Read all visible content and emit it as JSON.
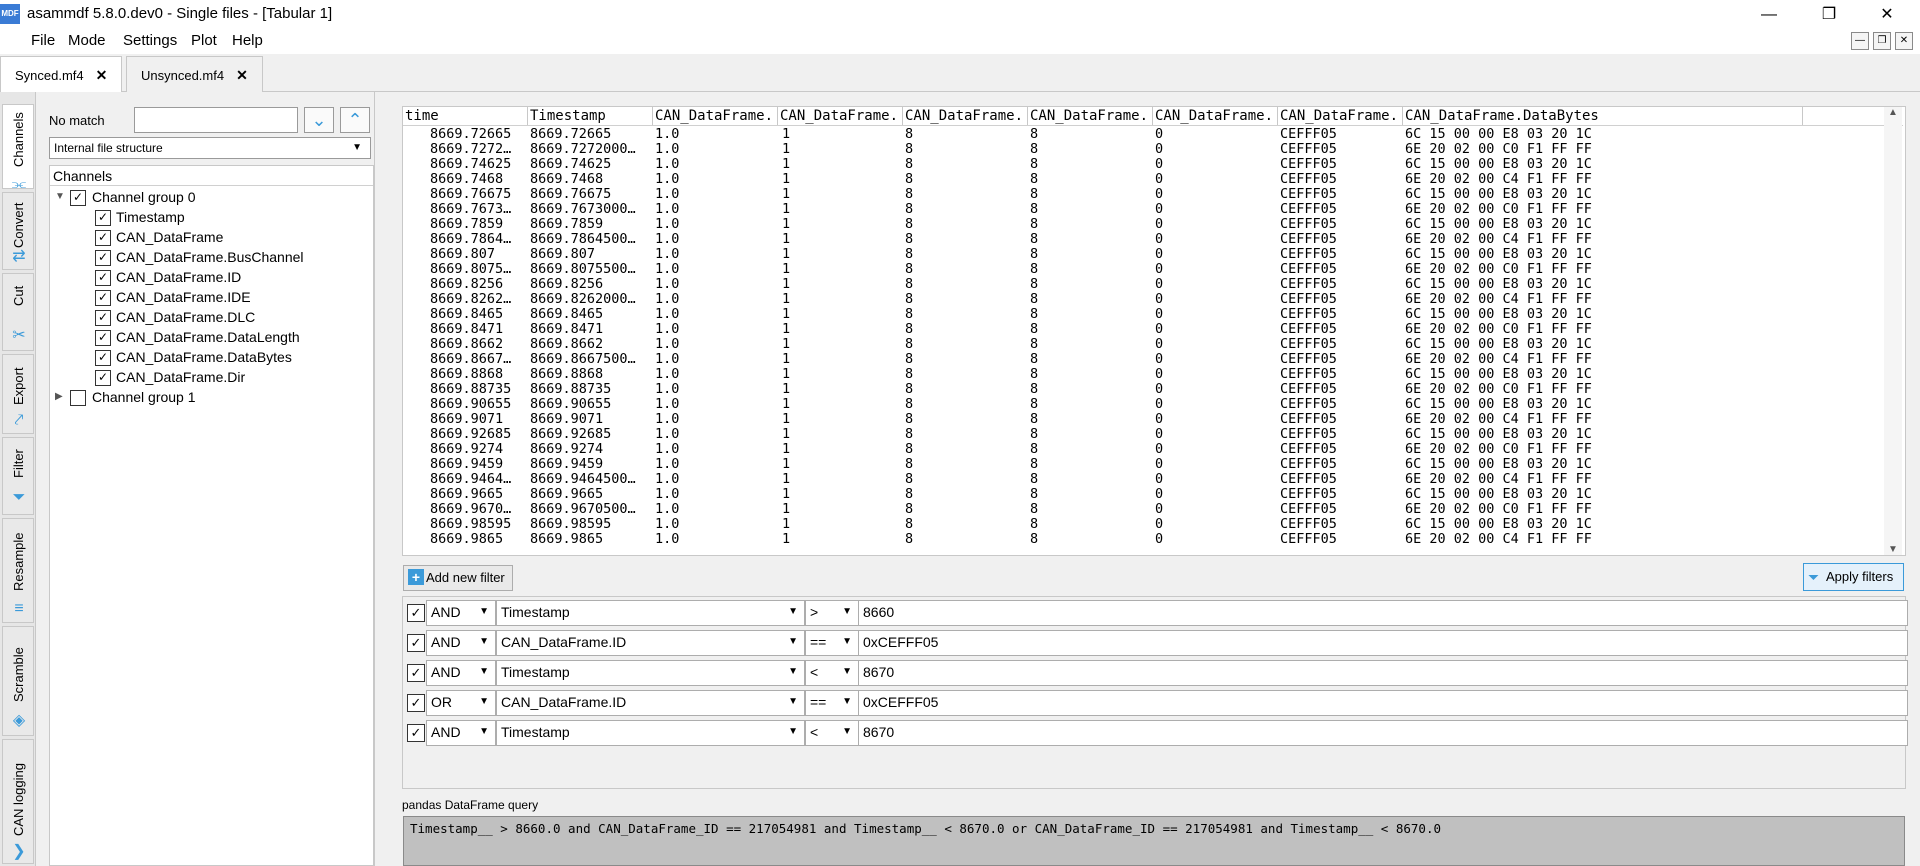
{
  "window": {
    "title": "asammdf 5.8.0.dev0 - Single files - [Tabular 1]",
    "logo_text": "MDF",
    "controls": {
      "minimize": "—",
      "maximize": "❐",
      "close": "✕"
    }
  },
  "menu": {
    "items": [
      "File",
      "Mode",
      "Settings",
      "Plot",
      "Help"
    ],
    "mdi_controls": {
      "minimize": "—",
      "restore": "❐",
      "close": "✕"
    }
  },
  "tabs": [
    {
      "label": "Synced.mf4",
      "close": "✕",
      "active": true
    },
    {
      "label": "Unsynced.mf4",
      "close": "✕",
      "active": false
    }
  ],
  "side_tabs": [
    {
      "label": "Channels",
      "icon": "channels-icon"
    },
    {
      "label": "Convert",
      "icon": "convert-icon"
    },
    {
      "label": "Cut",
      "icon": "scissors-icon"
    },
    {
      "label": "Export",
      "icon": "export-icon"
    },
    {
      "label": "Filter",
      "icon": "funnel-icon"
    },
    {
      "label": "Resample",
      "icon": "resample-icon"
    },
    {
      "label": "Scramble",
      "icon": "scramble-icon"
    },
    {
      "label": "CAN logging",
      "icon": "can-icon"
    }
  ],
  "channels_panel": {
    "match_status": "No match",
    "search_value": "",
    "view_mode": "Internal file structure",
    "tree_header": "Channels",
    "groups": [
      {
        "label": "Channel group 0",
        "checked": true,
        "expanded": true,
        "channels": [
          "Timestamp",
          "CAN_DataFrame",
          "CAN_DataFrame.BusChannel",
          "CAN_DataFrame.ID",
          "CAN_DataFrame.IDE",
          "CAN_DataFrame.DLC",
          "CAN_DataFrame.DataLength",
          "CAN_DataFrame.DataBytes",
          "CAN_DataFrame.Dir"
        ]
      },
      {
        "label": "Channel group 1",
        "checked": false,
        "expanded": false,
        "channels": []
      }
    ]
  },
  "table": {
    "columns": [
      "time",
      "Timestamp",
      "CAN_DataFrame.",
      "CAN_DataFrame.",
      "CAN_DataFrame.",
      "CAN_DataFrame.",
      "CAN_DataFrame.",
      "CAN_DataFrame.",
      "CAN_DataFrame.DataBytes"
    ],
    "rows": [
      [
        "8669.72665",
        "8669.72665",
        "1.0",
        "1",
        "8",
        "8",
        "0",
        "CEFFF05",
        "6C 15 00 00 E8 03 20 1C"
      ],
      [
        "8669.7272…",
        "8669.7272000…",
        "1.0",
        "1",
        "8",
        "8",
        "0",
        "CEFFF05",
        "6E 20 02 00 C0 F1 FF FF"
      ],
      [
        "8669.74625",
        "8669.74625",
        "1.0",
        "1",
        "8",
        "8",
        "0",
        "CEFFF05",
        "6C 15 00 00 E8 03 20 1C"
      ],
      [
        "8669.7468",
        "8669.7468",
        "1.0",
        "1",
        "8",
        "8",
        "0",
        "CEFFF05",
        "6E 20 02 00 C4 F1 FF FF"
      ],
      [
        "8669.76675",
        "8669.76675",
        "1.0",
        "1",
        "8",
        "8",
        "0",
        "CEFFF05",
        "6C 15 00 00 E8 03 20 1C"
      ],
      [
        "8669.7673…",
        "8669.7673000…",
        "1.0",
        "1",
        "8",
        "8",
        "0",
        "CEFFF05",
        "6E 20 02 00 C0 F1 FF FF"
      ],
      [
        "8669.7859",
        "8669.7859",
        "1.0",
        "1",
        "8",
        "8",
        "0",
        "CEFFF05",
        "6C 15 00 00 E8 03 20 1C"
      ],
      [
        "8669.7864…",
        "8669.7864500…",
        "1.0",
        "1",
        "8",
        "8",
        "0",
        "CEFFF05",
        "6E 20 02 00 C4 F1 FF FF"
      ],
      [
        "8669.807",
        "8669.807",
        "1.0",
        "1",
        "8",
        "8",
        "0",
        "CEFFF05",
        "6C 15 00 00 E8 03 20 1C"
      ],
      [
        "8669.8075…",
        "8669.8075500…",
        "1.0",
        "1",
        "8",
        "8",
        "0",
        "CEFFF05",
        "6E 20 02 00 C0 F1 FF FF"
      ],
      [
        "8669.8256",
        "8669.8256",
        "1.0",
        "1",
        "8",
        "8",
        "0",
        "CEFFF05",
        "6C 15 00 00 E8 03 20 1C"
      ],
      [
        "8669.8262…",
        "8669.8262000…",
        "1.0",
        "1",
        "8",
        "8",
        "0",
        "CEFFF05",
        "6E 20 02 00 C4 F1 FF FF"
      ],
      [
        "8669.8465",
        "8669.8465",
        "1.0",
        "1",
        "8",
        "8",
        "0",
        "CEFFF05",
        "6C 15 00 00 E8 03 20 1C"
      ],
      [
        "8669.8471",
        "8669.8471",
        "1.0",
        "1",
        "8",
        "8",
        "0",
        "CEFFF05",
        "6E 20 02 00 C0 F1 FF FF"
      ],
      [
        "8669.8662",
        "8669.8662",
        "1.0",
        "1",
        "8",
        "8",
        "0",
        "CEFFF05",
        "6C 15 00 00 E8 03 20 1C"
      ],
      [
        "8669.8667…",
        "8669.8667500…",
        "1.0",
        "1",
        "8",
        "8",
        "0",
        "CEFFF05",
        "6E 20 02 00 C4 F1 FF FF"
      ],
      [
        "8669.8868",
        "8669.8868",
        "1.0",
        "1",
        "8",
        "8",
        "0",
        "CEFFF05",
        "6C 15 00 00 E8 03 20 1C"
      ],
      [
        "8669.88735",
        "8669.88735",
        "1.0",
        "1",
        "8",
        "8",
        "0",
        "CEFFF05",
        "6E 20 02 00 C0 F1 FF FF"
      ],
      [
        "8669.90655",
        "8669.90655",
        "1.0",
        "1",
        "8",
        "8",
        "0",
        "CEFFF05",
        "6C 15 00 00 E8 03 20 1C"
      ],
      [
        "8669.9071",
        "8669.9071",
        "1.0",
        "1",
        "8",
        "8",
        "0",
        "CEFFF05",
        "6E 20 02 00 C4 F1 FF FF"
      ],
      [
        "8669.92685",
        "8669.92685",
        "1.0",
        "1",
        "8",
        "8",
        "0",
        "CEFFF05",
        "6C 15 00 00 E8 03 20 1C"
      ],
      [
        "8669.9274",
        "8669.9274",
        "1.0",
        "1",
        "8",
        "8",
        "0",
        "CEFFF05",
        "6E 20 02 00 C0 F1 FF FF"
      ],
      [
        "8669.9459",
        "8669.9459",
        "1.0",
        "1",
        "8",
        "8",
        "0",
        "CEFFF05",
        "6C 15 00 00 E8 03 20 1C"
      ],
      [
        "8669.9464…",
        "8669.9464500…",
        "1.0",
        "1",
        "8",
        "8",
        "0",
        "CEFFF05",
        "6E 20 02 00 C4 F1 FF FF"
      ],
      [
        "8669.9665",
        "8669.9665",
        "1.0",
        "1",
        "8",
        "8",
        "0",
        "CEFFF05",
        "6C 15 00 00 E8 03 20 1C"
      ],
      [
        "8669.9670…",
        "8669.9670500…",
        "1.0",
        "1",
        "8",
        "8",
        "0",
        "CEFFF05",
        "6E 20 02 00 C0 F1 FF FF"
      ],
      [
        "8669.98595",
        "8669.98595",
        "1.0",
        "1",
        "8",
        "8",
        "0",
        "CEFFF05",
        "6C 15 00 00 E8 03 20 1C"
      ],
      [
        "8669.9865",
        "8669.9865",
        "1.0",
        "1",
        "8",
        "8",
        "0",
        "CEFFF05",
        "6E 20 02 00 C4 F1 FF FF"
      ]
    ]
  },
  "filters": {
    "add_label": "Add new filter",
    "apply_label": "Apply filters",
    "rows": [
      {
        "enabled": true,
        "logic": "AND",
        "column": "Timestamp",
        "op": ">",
        "value": "8660"
      },
      {
        "enabled": true,
        "logic": "AND",
        "column": "CAN_DataFrame.ID",
        "op": "==",
        "value": "0xCEFFF05"
      },
      {
        "enabled": true,
        "logic": "AND",
        "column": "Timestamp",
        "op": "<",
        "value": "8670"
      },
      {
        "enabled": true,
        "logic": "OR",
        "column": "CAN_DataFrame.ID",
        "op": "==",
        "value": "0xCEFFF05"
      },
      {
        "enabled": true,
        "logic": "AND",
        "column": "Timestamp",
        "op": "<",
        "value": "8670"
      }
    ]
  },
  "query": {
    "label": "pandas DataFrame query",
    "text": "Timestamp__ > 8660.0 and CAN_DataFrame_ID == 217054981 and Timestamp__ < 8670.0 or CAN_DataFrame_ID == 217054981 and Timestamp__ < 8670.0"
  },
  "colors": {
    "accent": "#3b9ad9",
    "query_bg": "#c0c0c0"
  }
}
